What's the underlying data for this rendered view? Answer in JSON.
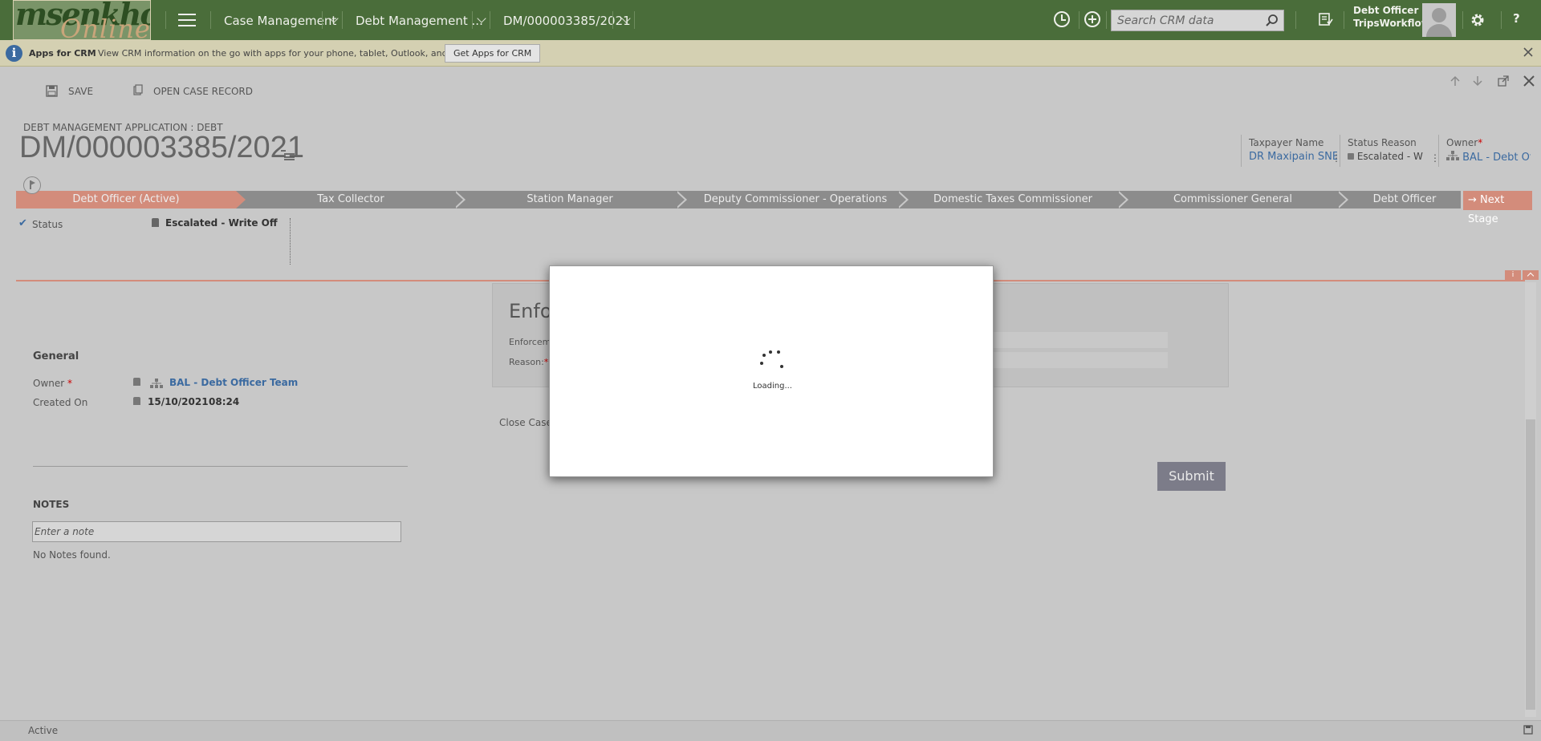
{
  "topnav": {
    "logo_line1": "msenkho",
    "logo_line2": "Online",
    "breadcrumbs": [
      "Case Management",
      "Debt Management ...",
      "DM/000003385/2021"
    ],
    "search_placeholder": "Search CRM data",
    "user_name": "Debt Officer",
    "user_org": "TripsWorkflow",
    "help": "?"
  },
  "infobar": {
    "title": "Apps for CRM",
    "message": "View CRM information on the go with apps for your phone, tablet, Outlook, and more!",
    "button": "Get Apps for CRM"
  },
  "commandbar": {
    "save": "SAVE",
    "open_case": "OPEN CASE RECORD"
  },
  "header": {
    "entity_type": "DEBT MANAGEMENT APPLICATION : DEBT",
    "record_title": "DM/000003385/2021",
    "fields": [
      {
        "label": "Taxpayer Name",
        "value": "DR Maxipain SNE"
      },
      {
        "label": "Status Reason",
        "value": "Escalated - W"
      },
      {
        "label": "Owner",
        "value": "BAL - Debt Of"
      }
    ]
  },
  "process": {
    "stages": [
      "Debt Officer (Active)",
      "Tax Collector",
      "Station Manager",
      "Deputy Commissioner - Operations",
      "Domestic Taxes Commissioner",
      "Commissioner General",
      "Debt Officer"
    ],
    "next_stage": "Next Stage",
    "step_label": "Status",
    "step_value": "Escalated - Write Off"
  },
  "general": {
    "heading": "General",
    "owner_label": "Owner",
    "owner_value": "BAL - Debt Officer Team",
    "created_label": "Created On",
    "created_date": "15/10/2021",
    "created_time": "08:24"
  },
  "notes": {
    "heading": "NOTES",
    "placeholder": "Enter a note",
    "empty": "No Notes found."
  },
  "form": {
    "title": "Enfo",
    "field1_label": "Enforcem",
    "field2_label": "Reason:",
    "close_label": "Close Case?",
    "submit": "Submit"
  },
  "modal": {
    "loading": "Loading..."
  },
  "statusbar": {
    "status": "Active"
  },
  "colors": {
    "nav_bg": "#4a6d3a",
    "active_stage": "#d38c7b",
    "link": "#3b6aa0"
  }
}
